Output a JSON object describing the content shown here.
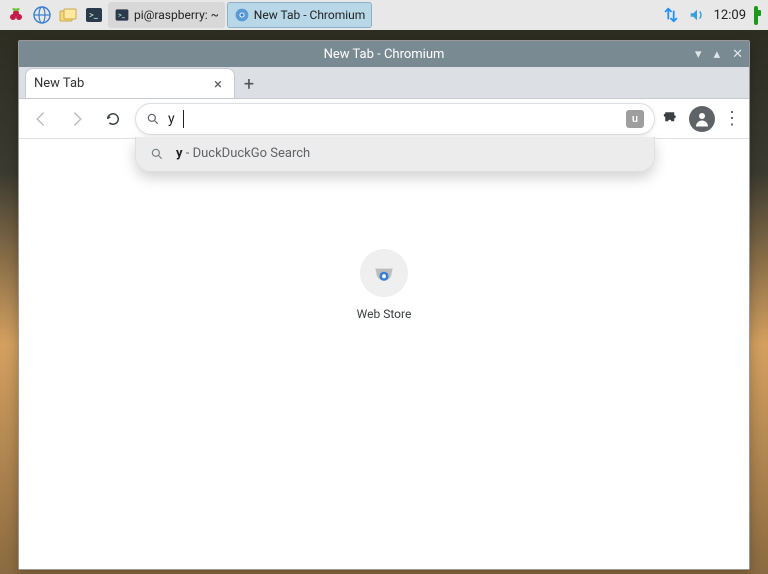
{
  "panel": {
    "tasks": [
      {
        "label": "pi@raspberry: ~",
        "kind": "terminal-min"
      },
      {
        "label": "New Tab - Chromium",
        "kind": "chromium-active"
      }
    ],
    "clock": "12:09"
  },
  "window": {
    "title": "New Tab - Chromium"
  },
  "tabs": [
    {
      "title": "New Tab"
    }
  ],
  "omnibox": {
    "query": "y",
    "ublock_badge": "u"
  },
  "suggestions": [
    {
      "match": "y",
      "rest": " - DuckDuckGo Search"
    }
  ],
  "ntp": {
    "shortcuts": [
      {
        "label": "Web Store"
      }
    ]
  }
}
